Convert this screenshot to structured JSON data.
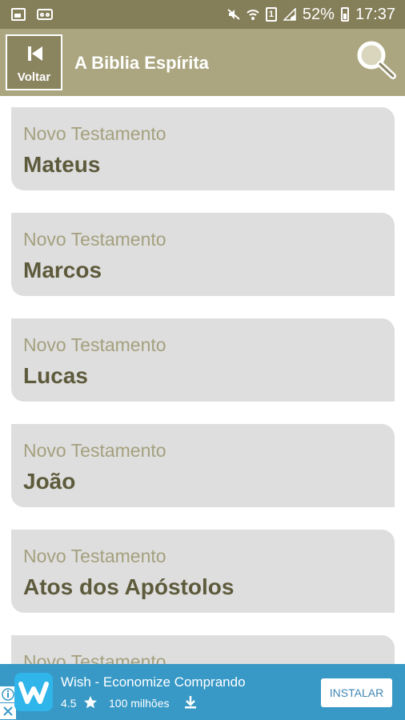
{
  "status_bar": {
    "battery": "52%",
    "time": "17:37",
    "sim_label": "1",
    "icons": [
      "image-icon",
      "voicemail-icon",
      "mute-icon",
      "wifi-icon",
      "sim-icon",
      "signal-icon",
      "battery-charging-icon"
    ]
  },
  "app_bar": {
    "back_label": "Voltar",
    "title": "A Biblia Espírita",
    "icons": [
      "skip-back-icon",
      "search-icon"
    ]
  },
  "books": [
    {
      "testament": "Novo Testamento",
      "name": "Mateus"
    },
    {
      "testament": "Novo Testamento",
      "name": "Marcos"
    },
    {
      "testament": "Novo Testamento",
      "name": "Lucas"
    },
    {
      "testament": "Novo Testamento",
      "name": "João"
    },
    {
      "testament": "Novo Testamento",
      "name": "Atos dos Apóstolos"
    },
    {
      "testament": "Novo Testamento",
      "name": ""
    }
  ],
  "ad": {
    "title": "Wish - Economize Comprando",
    "rating": "4.5",
    "downloads": "100 milhões",
    "install_label": "INSTALAR",
    "icons": [
      "ad-info-icon",
      "close-icon",
      "wish-logo",
      "star-icon",
      "download-icon"
    ]
  },
  "colors": {
    "status_bar_bg": "#847e59",
    "app_bar_bg": "#aba67f",
    "card_bg": "#dedede",
    "subtitle_text": "#a4a07e",
    "title_text": "#5e5a3c",
    "ad_bg": "#3899c6"
  }
}
